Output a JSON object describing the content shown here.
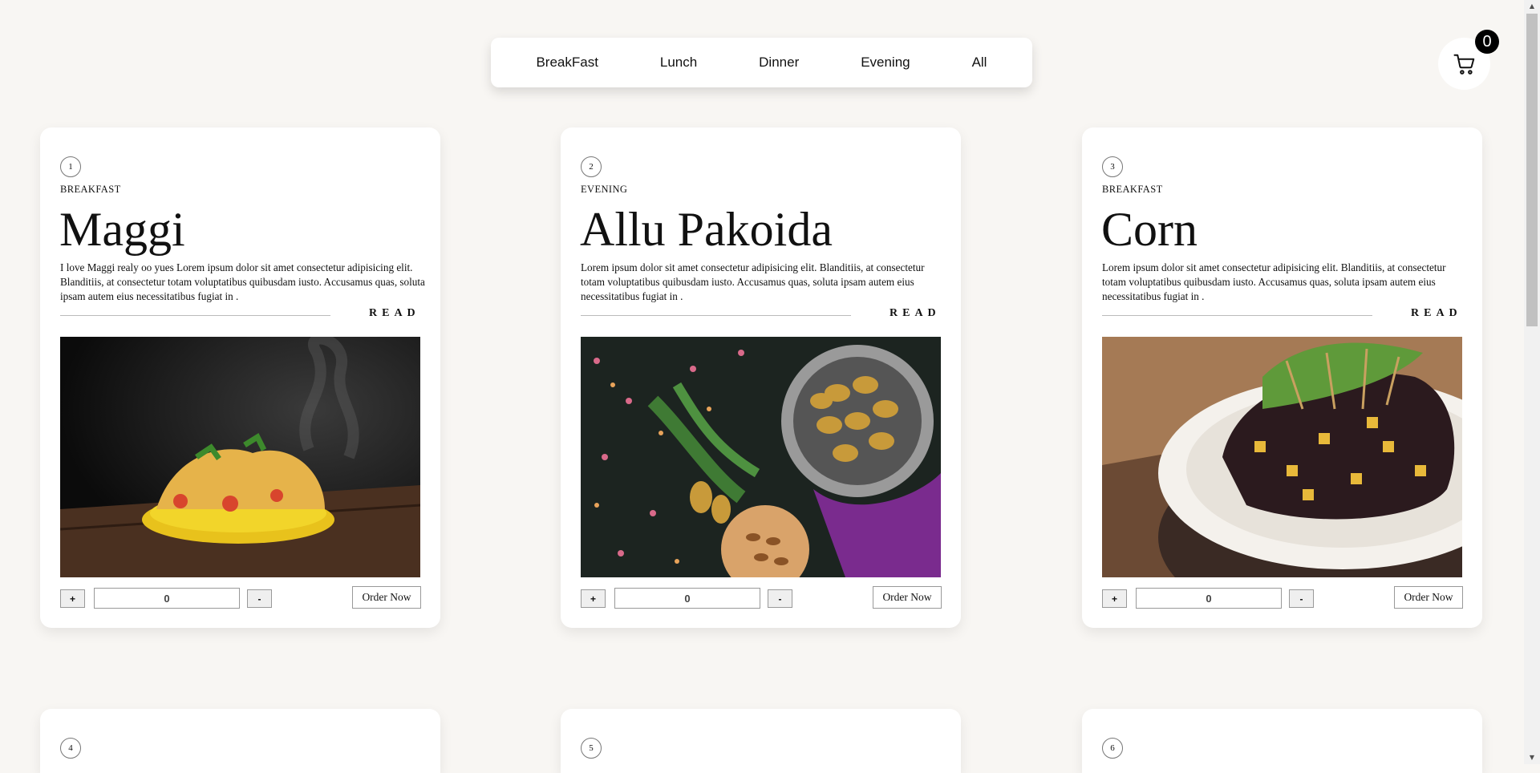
{
  "nav": {
    "items": [
      "BreakFast",
      "Lunch",
      "Dinner",
      "Evening",
      "All"
    ]
  },
  "cart": {
    "count": "0",
    "icon": "cart-icon"
  },
  "controls": {
    "plus": "+",
    "minus": "-",
    "quantity": "0",
    "order": "Order Now",
    "read": "READ"
  },
  "cards": [
    {
      "number": "1",
      "category": "BREAKFAST",
      "title": "Maggi",
      "description": "I love Maggi realy oo yues Lorem ipsum dolor sit amet consectetur adipisicing elit. Blanditiis, at consectetur totam voluptatibus quibusdam iusto. Accusamus quas, soluta ipsam autem eius necessitatibus fugiat in ."
    },
    {
      "number": "2",
      "category": "EVENING",
      "title": "Allu Pakoida",
      "description": "Lorem ipsum dolor sit amet consectetur adipisicing elit. Blanditiis, at consectetur totam voluptatibus quibusdam iusto. Accusamus quas, soluta ipsam autem eius necessitatibus fugiat in ."
    },
    {
      "number": "3",
      "category": "BREAKFAST",
      "title": "Corn",
      "description": "Lorem ipsum dolor sit amet consectetur adipisicing elit. Blanditiis, at consectetur totam voluptatibus quibusdam iusto. Accusamus quas, soluta ipsam autem eius necessitatibus fugiat in ."
    }
  ],
  "next_cards": [
    {
      "number": "4"
    },
    {
      "number": "5"
    },
    {
      "number": "6"
    }
  ]
}
